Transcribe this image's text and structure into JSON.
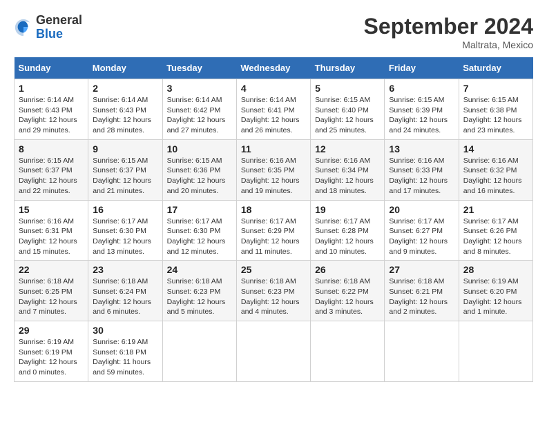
{
  "header": {
    "logo_general": "General",
    "logo_blue": "Blue",
    "month": "September 2024",
    "location": "Maltrata, Mexico"
  },
  "days_of_week": [
    "Sunday",
    "Monday",
    "Tuesday",
    "Wednesday",
    "Thursday",
    "Friday",
    "Saturday"
  ],
  "weeks": [
    [
      {
        "day": "1",
        "sunrise": "6:14 AM",
        "sunset": "6:43 PM",
        "daylight": "12 hours and 29 minutes."
      },
      {
        "day": "2",
        "sunrise": "6:14 AM",
        "sunset": "6:43 PM",
        "daylight": "12 hours and 28 minutes."
      },
      {
        "day": "3",
        "sunrise": "6:14 AM",
        "sunset": "6:42 PM",
        "daylight": "12 hours and 27 minutes."
      },
      {
        "day": "4",
        "sunrise": "6:14 AM",
        "sunset": "6:41 PM",
        "daylight": "12 hours and 26 minutes."
      },
      {
        "day": "5",
        "sunrise": "6:15 AM",
        "sunset": "6:40 PM",
        "daylight": "12 hours and 25 minutes."
      },
      {
        "day": "6",
        "sunrise": "6:15 AM",
        "sunset": "6:39 PM",
        "daylight": "12 hours and 24 minutes."
      },
      {
        "day": "7",
        "sunrise": "6:15 AM",
        "sunset": "6:38 PM",
        "daylight": "12 hours and 23 minutes."
      }
    ],
    [
      {
        "day": "8",
        "sunrise": "6:15 AM",
        "sunset": "6:37 PM",
        "daylight": "12 hours and 22 minutes."
      },
      {
        "day": "9",
        "sunrise": "6:15 AM",
        "sunset": "6:37 PM",
        "daylight": "12 hours and 21 minutes."
      },
      {
        "day": "10",
        "sunrise": "6:15 AM",
        "sunset": "6:36 PM",
        "daylight": "12 hours and 20 minutes."
      },
      {
        "day": "11",
        "sunrise": "6:16 AM",
        "sunset": "6:35 PM",
        "daylight": "12 hours and 19 minutes."
      },
      {
        "day": "12",
        "sunrise": "6:16 AM",
        "sunset": "6:34 PM",
        "daylight": "12 hours and 18 minutes."
      },
      {
        "day": "13",
        "sunrise": "6:16 AM",
        "sunset": "6:33 PM",
        "daylight": "12 hours and 17 minutes."
      },
      {
        "day": "14",
        "sunrise": "6:16 AM",
        "sunset": "6:32 PM",
        "daylight": "12 hours and 16 minutes."
      }
    ],
    [
      {
        "day": "15",
        "sunrise": "6:16 AM",
        "sunset": "6:31 PM",
        "daylight": "12 hours and 15 minutes."
      },
      {
        "day": "16",
        "sunrise": "6:17 AM",
        "sunset": "6:30 PM",
        "daylight": "12 hours and 13 minutes."
      },
      {
        "day": "17",
        "sunrise": "6:17 AM",
        "sunset": "6:30 PM",
        "daylight": "12 hours and 12 minutes."
      },
      {
        "day": "18",
        "sunrise": "6:17 AM",
        "sunset": "6:29 PM",
        "daylight": "12 hours and 11 minutes."
      },
      {
        "day": "19",
        "sunrise": "6:17 AM",
        "sunset": "6:28 PM",
        "daylight": "12 hours and 10 minutes."
      },
      {
        "day": "20",
        "sunrise": "6:17 AM",
        "sunset": "6:27 PM",
        "daylight": "12 hours and 9 minutes."
      },
      {
        "day": "21",
        "sunrise": "6:17 AM",
        "sunset": "6:26 PM",
        "daylight": "12 hours and 8 minutes."
      }
    ],
    [
      {
        "day": "22",
        "sunrise": "6:18 AM",
        "sunset": "6:25 PM",
        "daylight": "12 hours and 7 minutes."
      },
      {
        "day": "23",
        "sunrise": "6:18 AM",
        "sunset": "6:24 PM",
        "daylight": "12 hours and 6 minutes."
      },
      {
        "day": "24",
        "sunrise": "6:18 AM",
        "sunset": "6:23 PM",
        "daylight": "12 hours and 5 minutes."
      },
      {
        "day": "25",
        "sunrise": "6:18 AM",
        "sunset": "6:23 PM",
        "daylight": "12 hours and 4 minutes."
      },
      {
        "day": "26",
        "sunrise": "6:18 AM",
        "sunset": "6:22 PM",
        "daylight": "12 hours and 3 minutes."
      },
      {
        "day": "27",
        "sunrise": "6:18 AM",
        "sunset": "6:21 PM",
        "daylight": "12 hours and 2 minutes."
      },
      {
        "day": "28",
        "sunrise": "6:19 AM",
        "sunset": "6:20 PM",
        "daylight": "12 hours and 1 minute."
      }
    ],
    [
      {
        "day": "29",
        "sunrise": "6:19 AM",
        "sunset": "6:19 PM",
        "daylight": "12 hours and 0 minutes."
      },
      {
        "day": "30",
        "sunrise": "6:19 AM",
        "sunset": "6:18 PM",
        "daylight": "11 hours and 59 minutes."
      },
      null,
      null,
      null,
      null,
      null
    ]
  ]
}
